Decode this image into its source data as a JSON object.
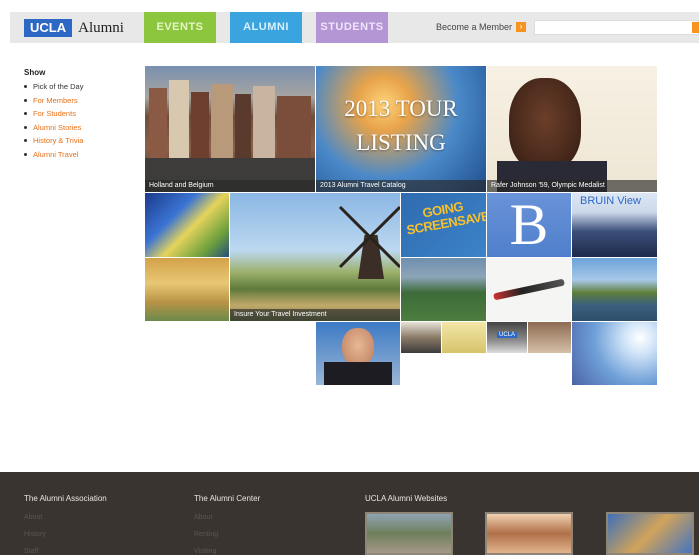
{
  "header": {
    "logo_ucla": "UCLA",
    "logo_alumni": "Alumni",
    "tabs": [
      {
        "label": "EVENTS",
        "color": "#8cc63f"
      },
      {
        "label": "ALUMNI",
        "color": "#3aa4df"
      },
      {
        "label": "STUDENTS",
        "color": "#b596d4"
      }
    ],
    "become_member": "Become a Member",
    "search_placeholder": ""
  },
  "sidebar": {
    "title": "Show",
    "items": [
      {
        "label": "Pick of the Day"
      },
      {
        "label": "For Members"
      },
      {
        "label": "For Students"
      },
      {
        "label": "Alumni Stories"
      },
      {
        "label": "History & Trivia"
      },
      {
        "label": "Alumni Travel"
      }
    ]
  },
  "tiles": {
    "holland_caption": "Holland and Belgium",
    "tour_title_1": "2013 TOUR",
    "tour_title_2": "LISTING",
    "tour_caption": "2013 Alumni Travel Catalog",
    "rafer_caption": "Rafer Johnson '59, Olympic Medalist",
    "windmill_caption": "Insure Your Travel Investment",
    "going_text_1": "GOING",
    "going_text_2": "SCREENSAVER",
    "b_letter": "B",
    "bruin_view": "BRUIN View",
    "ucla_chip": "UCLA"
  },
  "footer": {
    "columns": [
      {
        "title": "The Alumni Association",
        "links": [
          "About",
          "History",
          "Staff"
        ]
      },
      {
        "title": "The Alumni Center",
        "links": [
          "About",
          "Renting",
          "Visiting"
        ]
      },
      {
        "title": "UCLA Alumni Websites",
        "links": []
      }
    ]
  },
  "colors": {
    "accent_orange": "#f7931e",
    "ucla_blue": "#2d68c4",
    "footer_bg": "#3a3430"
  }
}
